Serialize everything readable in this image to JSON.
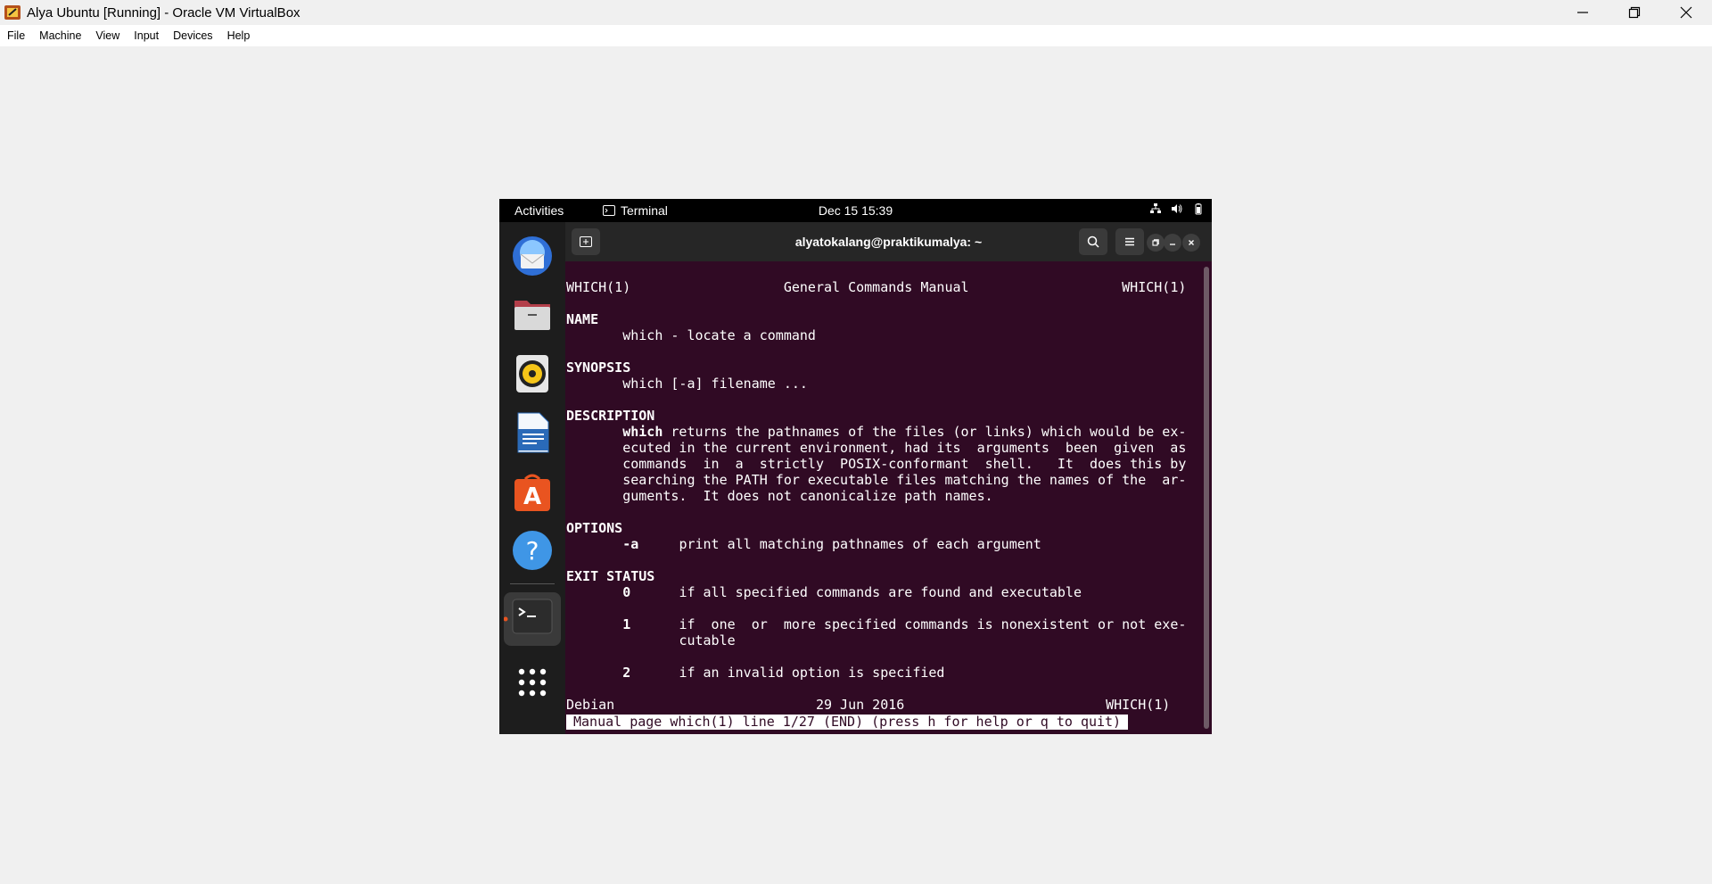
{
  "host": {
    "title": "Alya Ubuntu [Running] - Oracle VM VirtualBox",
    "menu": [
      "File",
      "Machine",
      "View",
      "Input",
      "Devices",
      "Help"
    ]
  },
  "ubuntu": {
    "activities": "Activities",
    "app_name": "Terminal",
    "clock": "Dec 15  15:39",
    "dock": [
      "thunderbird-icon",
      "files-icon",
      "rhythmbox-icon",
      "writer-icon",
      "app-center-icon",
      "help-icon",
      "terminal-icon",
      "show-apps-icon"
    ]
  },
  "terminal": {
    "title": "alyatokalang@praktikumalya: ~",
    "header": {
      "left": "WHICH(1)",
      "center": "General Commands Manual",
      "right": "WHICH(1)"
    },
    "name_heading": "NAME",
    "name_text": "which - locate a command",
    "synopsis_heading": "SYNOPSIS",
    "synopsis_text": "which [-a] filename ...",
    "description_heading": "DESCRIPTION",
    "desc_word": "which",
    "desc_line1": " returns the pathnames of the files (or links) which would be ex-",
    "desc_line2": "ecuted in the current environment, had its  arguments  been  given  as",
    "desc_line3": "commands  in  a  strictly  POSIX-conformant  shell.   It  does this by",
    "desc_line4": "searching the PATH for executable files matching the names of the  ar-",
    "desc_line5": "guments.  It does not canonicalize path names.",
    "options_heading": "OPTIONS",
    "opt_flag": "-a",
    "opt_text": "print all matching pathnames of each argument",
    "exit_heading": "EXIT STATUS",
    "exit0_code": "0",
    "exit0_text": "if all specified commands are found and executable",
    "exit1_code": "1",
    "exit1_text": "if  one  or  more specified commands is nonexistent or not exe-",
    "exit1_text2": "cutable",
    "exit2_code": "2",
    "exit2_text": "if an invalid option is specified",
    "footer": {
      "left": "Debian",
      "center": "29 Jun 2016",
      "right": "WHICH(1)"
    },
    "status": "Manual page which(1) line 1/27 (END) (press h for help or q to quit)"
  }
}
